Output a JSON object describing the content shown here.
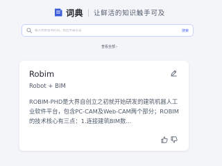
{
  "header": {
    "logo_text": "词典",
    "slogan": "让鲜活的知识触手可及"
  },
  "search": {
    "placeholder": "输入你想查询的词，找回专属答案",
    "button_label": "搜索"
  },
  "view_all": {
    "label": "查看全部"
  },
  "card": {
    "title": "Robim",
    "subtitle": "Robot + BIM",
    "description": "ROBIM-PHD是大界自创立之初就开始研发的建筑机器人工业软件平台，包含PC-CAM及Web-CAM两个部分；ROBIM的技术核心有三点：1.连接建筑BIM数..."
  },
  "icons": {
    "logo": "dictionary-logo-icon",
    "search": "search-icon",
    "chevron": "chevron-right-icon",
    "edit": "edit-pencil-icon",
    "like": "thumbs-up-icon",
    "dislike": "thumbs-down-icon"
  },
  "colors": {
    "background": "#f4f5f9",
    "accent": "#4f6ef7",
    "logo": "#3b5bdb",
    "text": "#1f2329",
    "muted": "#4e5969"
  }
}
